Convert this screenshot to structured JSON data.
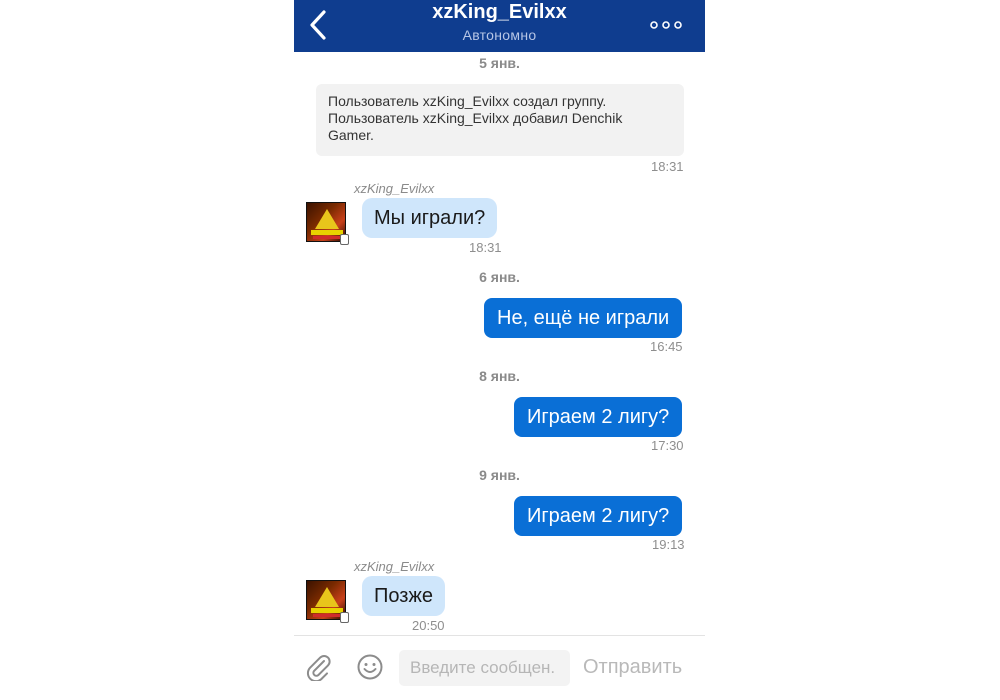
{
  "header": {
    "title": "xzKing_Evilxx",
    "subtitle": "Автономно"
  },
  "messages": {
    "date1": "5 янв.",
    "system_line1": "Пользователь xzKing_Evilxx создал группу.",
    "system_line2": "Пользователь xzKing_Evilxx добавил Denchik",
    "system_line3": "Gamer.",
    "system_time": "18:31",
    "msg1_sender": "xzKing_Evilxx",
    "msg1_text": "Мы играли?",
    "msg1_time": "18:31",
    "date2": "6 янв.",
    "msg2_text": "Не, ещё не играли",
    "msg2_time": "16:45",
    "date3": "8 янв.",
    "msg3_text": "Играем 2 лигу?",
    "msg3_time": "17:30",
    "date4": "9 янв.",
    "msg4_text": "Играем 2 лигу?",
    "msg4_time": "19:13",
    "msg5_sender": "xzKing_Evilxx",
    "msg5_text": "Позже",
    "msg5_time": "20:50"
  },
  "composer": {
    "placeholder": "Введите сообщен.",
    "send_label": "Отправить"
  },
  "colors": {
    "header_bg": "#0f3d8f",
    "outgoing_bubble": "#0a6fd6",
    "incoming_bubble": "#cfe6fb"
  },
  "icons": {
    "back": "chevron-left-icon",
    "more": "more-dots-icon",
    "attach": "paperclip-icon",
    "emoji": "smiley-icon"
  }
}
